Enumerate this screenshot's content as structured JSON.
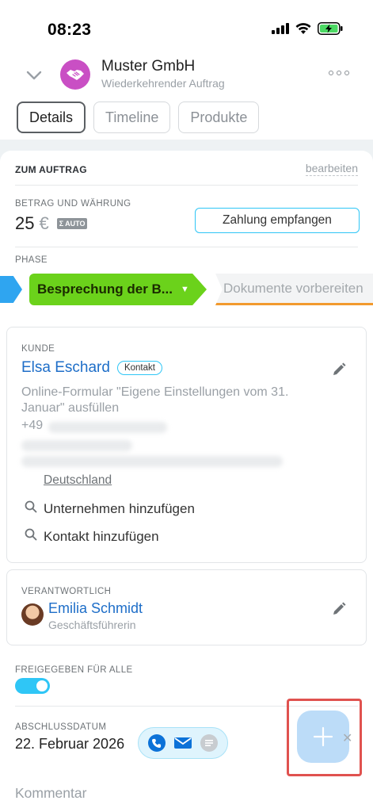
{
  "status_bar": {
    "time": "08:23"
  },
  "header": {
    "title": "Muster GmbH",
    "subtitle": "Wiederkehrender Auftrag"
  },
  "tabs": [
    {
      "label": "Details",
      "active": true
    },
    {
      "label": "Timeline",
      "active": false
    },
    {
      "label": "Produkte",
      "active": false
    }
  ],
  "deal": {
    "section_title": "ZUM AUFTRAG",
    "edit_label": "bearbeiten",
    "amount_label": "BETRAG UND WÄHRUNG",
    "amount": "25",
    "currency": "€",
    "auto_badge": "AUTO",
    "auto_symbol": "Σ",
    "pay_button": "Zahlung empfangen",
    "phase_label": "PHASE",
    "phase_current": "Besprechung der B...",
    "phase_next": "Dokumente vorbereiten",
    "phase_current_color": "#6bd21b",
    "phase_next_accent": "#f29a2e"
  },
  "client": {
    "label": "KUNDE",
    "name": "Elsa Eschard",
    "badge": "Kontakt",
    "description": "Online-Formular \"Eigene Einstellungen vom 31. Januar\" ausfüllen",
    "phone_prefix": "+49",
    "country": "Deutschland",
    "add_company": "Unternehmen hinzufügen",
    "add_contact": "Kontakt hinzufügen"
  },
  "responsible": {
    "label": "VERANTWORTLICH",
    "name": "Emilia Schmidt",
    "role": "Geschäftsführerin"
  },
  "shared": {
    "label": "FREIGEGEBEN FÜR ALLE",
    "enabled": true
  },
  "close_date": {
    "label": "ABSCHLUSSDATUM",
    "value": "22. Februar 2026"
  },
  "comment": {
    "label": "Kommentar"
  },
  "colors": {
    "accent": "#2fc6f6",
    "link": "#1e6ec8",
    "fab": "#bcdcf8",
    "highlight": "#e0524f"
  }
}
